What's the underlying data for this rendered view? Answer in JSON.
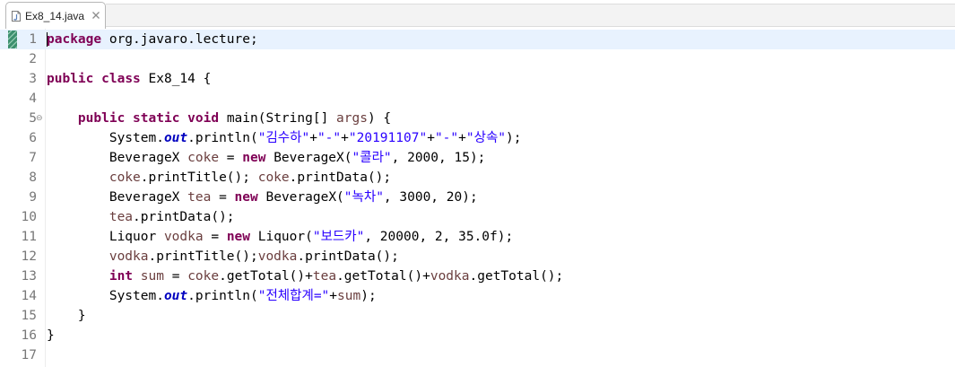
{
  "tab": {
    "title": "Ex8_14.java",
    "file_icon": "java-file-icon",
    "close_icon": "close-icon"
  },
  "lines": [
    {
      "n": "1",
      "tokens": [
        {
          "t": "package",
          "c": "kw"
        },
        {
          "t": " org.javaro.lecture;",
          "c": ""
        }
      ]
    },
    {
      "n": "2",
      "tokens": []
    },
    {
      "n": "3",
      "tokens": [
        {
          "t": "public",
          "c": "kw"
        },
        {
          "t": " ",
          "c": ""
        },
        {
          "t": "class",
          "c": "kw"
        },
        {
          "t": " Ex8_14 {",
          "c": ""
        }
      ]
    },
    {
      "n": "4",
      "tokens": []
    },
    {
      "n": "5",
      "tokens": [
        {
          "t": "    ",
          "c": ""
        },
        {
          "t": "public",
          "c": "kw"
        },
        {
          "t": " ",
          "c": ""
        },
        {
          "t": "static",
          "c": "kw"
        },
        {
          "t": " ",
          "c": ""
        },
        {
          "t": "void",
          "c": "kw"
        },
        {
          "t": " main(String[] ",
          "c": ""
        },
        {
          "t": "args",
          "c": "vr"
        },
        {
          "t": ") {",
          "c": ""
        }
      ]
    },
    {
      "n": "6",
      "tokens": [
        {
          "t": "        System.",
          "c": ""
        },
        {
          "t": "out",
          "c": "fi"
        },
        {
          "t": ".println(",
          "c": ""
        },
        {
          "t": "\"김수하\"",
          "c": "st"
        },
        {
          "t": "+",
          "c": ""
        },
        {
          "t": "\"-\"",
          "c": "st"
        },
        {
          "t": "+",
          "c": ""
        },
        {
          "t": "\"20191107\"",
          "c": "st"
        },
        {
          "t": "+",
          "c": ""
        },
        {
          "t": "\"-\"",
          "c": "st"
        },
        {
          "t": "+",
          "c": ""
        },
        {
          "t": "\"상속\"",
          "c": "st"
        },
        {
          "t": ");",
          "c": ""
        }
      ]
    },
    {
      "n": "7",
      "tokens": [
        {
          "t": "        BeverageX ",
          "c": ""
        },
        {
          "t": "coke",
          "c": "vr"
        },
        {
          "t": " = ",
          "c": ""
        },
        {
          "t": "new",
          "c": "kw"
        },
        {
          "t": " BeverageX(",
          "c": ""
        },
        {
          "t": "\"콜라\"",
          "c": "st"
        },
        {
          "t": ", 2000, 15);",
          "c": ""
        }
      ]
    },
    {
      "n": "8",
      "tokens": [
        {
          "t": "        ",
          "c": ""
        },
        {
          "t": "coke",
          "c": "vr"
        },
        {
          "t": ".printTitle(); ",
          "c": ""
        },
        {
          "t": "coke",
          "c": "vr"
        },
        {
          "t": ".printData();",
          "c": ""
        }
      ]
    },
    {
      "n": "9",
      "tokens": [
        {
          "t": "        BeverageX ",
          "c": ""
        },
        {
          "t": "tea",
          "c": "vr"
        },
        {
          "t": " = ",
          "c": ""
        },
        {
          "t": "new",
          "c": "kw"
        },
        {
          "t": " BeverageX(",
          "c": ""
        },
        {
          "t": "\"녹차\"",
          "c": "st"
        },
        {
          "t": ", 3000, 20);",
          "c": ""
        }
      ]
    },
    {
      "n": "10",
      "tokens": [
        {
          "t": "        ",
          "c": ""
        },
        {
          "t": "tea",
          "c": "vr"
        },
        {
          "t": ".printData();",
          "c": ""
        }
      ]
    },
    {
      "n": "11",
      "tokens": [
        {
          "t": "        Liquor ",
          "c": ""
        },
        {
          "t": "vodka",
          "c": "vr"
        },
        {
          "t": " = ",
          "c": ""
        },
        {
          "t": "new",
          "c": "kw"
        },
        {
          "t": " Liquor(",
          "c": ""
        },
        {
          "t": "\"보드카\"",
          "c": "st"
        },
        {
          "t": ", 20000, 2, 35.0f);",
          "c": ""
        }
      ]
    },
    {
      "n": "12",
      "tokens": [
        {
          "t": "        ",
          "c": ""
        },
        {
          "t": "vodka",
          "c": "vr"
        },
        {
          "t": ".printTitle();",
          "c": ""
        },
        {
          "t": "vodka",
          "c": "vr"
        },
        {
          "t": ".printData();",
          "c": ""
        }
      ]
    },
    {
      "n": "13",
      "tokens": [
        {
          "t": "        ",
          "c": ""
        },
        {
          "t": "int",
          "c": "kw"
        },
        {
          "t": " ",
          "c": ""
        },
        {
          "t": "sum",
          "c": "vr"
        },
        {
          "t": " = ",
          "c": ""
        },
        {
          "t": "coke",
          "c": "vr"
        },
        {
          "t": ".getTotal()+",
          "c": ""
        },
        {
          "t": "tea",
          "c": "vr"
        },
        {
          "t": ".getTotal()+",
          "c": ""
        },
        {
          "t": "vodka",
          "c": "vr"
        },
        {
          "t": ".getTotal();",
          "c": ""
        }
      ]
    },
    {
      "n": "14",
      "tokens": [
        {
          "t": "        System.",
          "c": ""
        },
        {
          "t": "out",
          "c": "fi"
        },
        {
          "t": ".println(",
          "c": ""
        },
        {
          "t": "\"전체합계=\"",
          "c": "st"
        },
        {
          "t": "+",
          "c": ""
        },
        {
          "t": "sum",
          "c": "vr"
        },
        {
          "t": ");",
          "c": ""
        }
      ]
    },
    {
      "n": "15",
      "tokens": [
        {
          "t": "    }",
          "c": ""
        }
      ]
    },
    {
      "n": "16",
      "tokens": [
        {
          "t": "}",
          "c": ""
        }
      ]
    },
    {
      "n": "17",
      "tokens": []
    }
  ],
  "current_line": 1,
  "fold_line": 5,
  "fold_icon": "fold-collapse-icon",
  "change_marker_icon": "change-marker-icon",
  "colors": {
    "keyword": "#7f0055",
    "string": "#2a00ff",
    "field": "#0000c0",
    "variable": "#6a3e3e",
    "line_highlight": "#e8f2fe",
    "line_number": "#787878"
  }
}
